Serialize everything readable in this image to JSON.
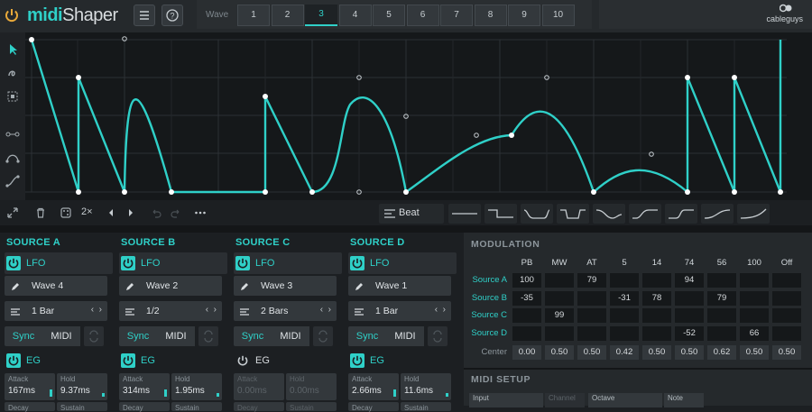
{
  "header": {
    "app_name_bold": "midi",
    "app_name_light": "Shaper",
    "wave_label": "Wave",
    "wave_tabs": [
      "1",
      "2",
      "3",
      "4",
      "5",
      "6",
      "7",
      "8",
      "9",
      "10"
    ],
    "active_wave": "3",
    "brand": "cableguys"
  },
  "toolbar": {
    "double_label": "2×",
    "beat_label": "Beat"
  },
  "sources": [
    {
      "title": "SOURCE A",
      "lfo_label": "LFO",
      "wave": "Wave 4",
      "rate": "1 Bar",
      "sync": "Sync",
      "midi": "MIDI",
      "eg_label": "EG",
      "eg_on": true,
      "attack_label": "Attack",
      "attack": "167ms",
      "hold_label": "Hold",
      "hold": "9.37ms",
      "decay_label": "Decay",
      "sustain_label": "Sustain"
    },
    {
      "title": "SOURCE B",
      "lfo_label": "LFO",
      "wave": "Wave 2",
      "rate": "1/2",
      "sync": "Sync",
      "midi": "MIDI",
      "eg_label": "EG",
      "eg_on": true,
      "attack_label": "Attack",
      "attack": "314ms",
      "hold_label": "Hold",
      "hold": "1.95ms",
      "decay_label": "Decay",
      "sustain_label": "Sustain"
    },
    {
      "title": "SOURCE C",
      "lfo_label": "LFO",
      "wave": "Wave 3",
      "rate": "2 Bars",
      "sync": "Sync",
      "midi": "MIDI",
      "eg_label": "EG",
      "eg_on": false,
      "attack_label": "Attack",
      "attack": "0.00ms",
      "hold_label": "Hold",
      "hold": "0.00ms",
      "decay_label": "Decay",
      "sustain_label": "Sustain"
    },
    {
      "title": "SOURCE D",
      "lfo_label": "LFO",
      "wave": "Wave 1",
      "rate": "1 Bar",
      "sync": "Sync",
      "midi": "MIDI",
      "eg_label": "EG",
      "eg_on": true,
      "attack_label": "Attack",
      "attack": "2.66ms",
      "hold_label": "Hold",
      "hold": "11.6ms",
      "decay_label": "Decay",
      "sustain_label": "Sustain"
    }
  ],
  "modulation": {
    "title": "MODULATION",
    "columns": [
      "PB",
      "MW",
      "AT",
      "5",
      "14",
      "74",
      "56",
      "100",
      "Off"
    ],
    "rows": [
      {
        "label": "Source A",
        "cells": [
          "100",
          "",
          "79",
          "",
          "",
          "94",
          "",
          "",
          ""
        ]
      },
      {
        "label": "Source B",
        "cells": [
          "-35",
          "",
          "",
          "-31",
          "78",
          "",
          "79",
          "",
          ""
        ]
      },
      {
        "label": "Source C",
        "cells": [
          "",
          "99",
          "",
          "",
          "",
          "",
          "",
          "",
          ""
        ]
      },
      {
        "label": "Source D",
        "cells": [
          "",
          "",
          "",
          "",
          "",
          "-52",
          "",
          "66",
          ""
        ]
      }
    ],
    "center_label": "Center",
    "center": [
      "0.00",
      "0.50",
      "0.50",
      "0.42",
      "0.50",
      "0.50",
      "0.62",
      "0.50",
      "0.50"
    ]
  },
  "midi_setup": {
    "title": "MIDI SETUP",
    "input_label": "Input",
    "channel_label": "Channel",
    "octave_label": "Octave",
    "note_label": "Note"
  },
  "colors": {
    "accent": "#2fd0c8",
    "background": "#1c1f22",
    "graph_bg": "#15181a"
  }
}
